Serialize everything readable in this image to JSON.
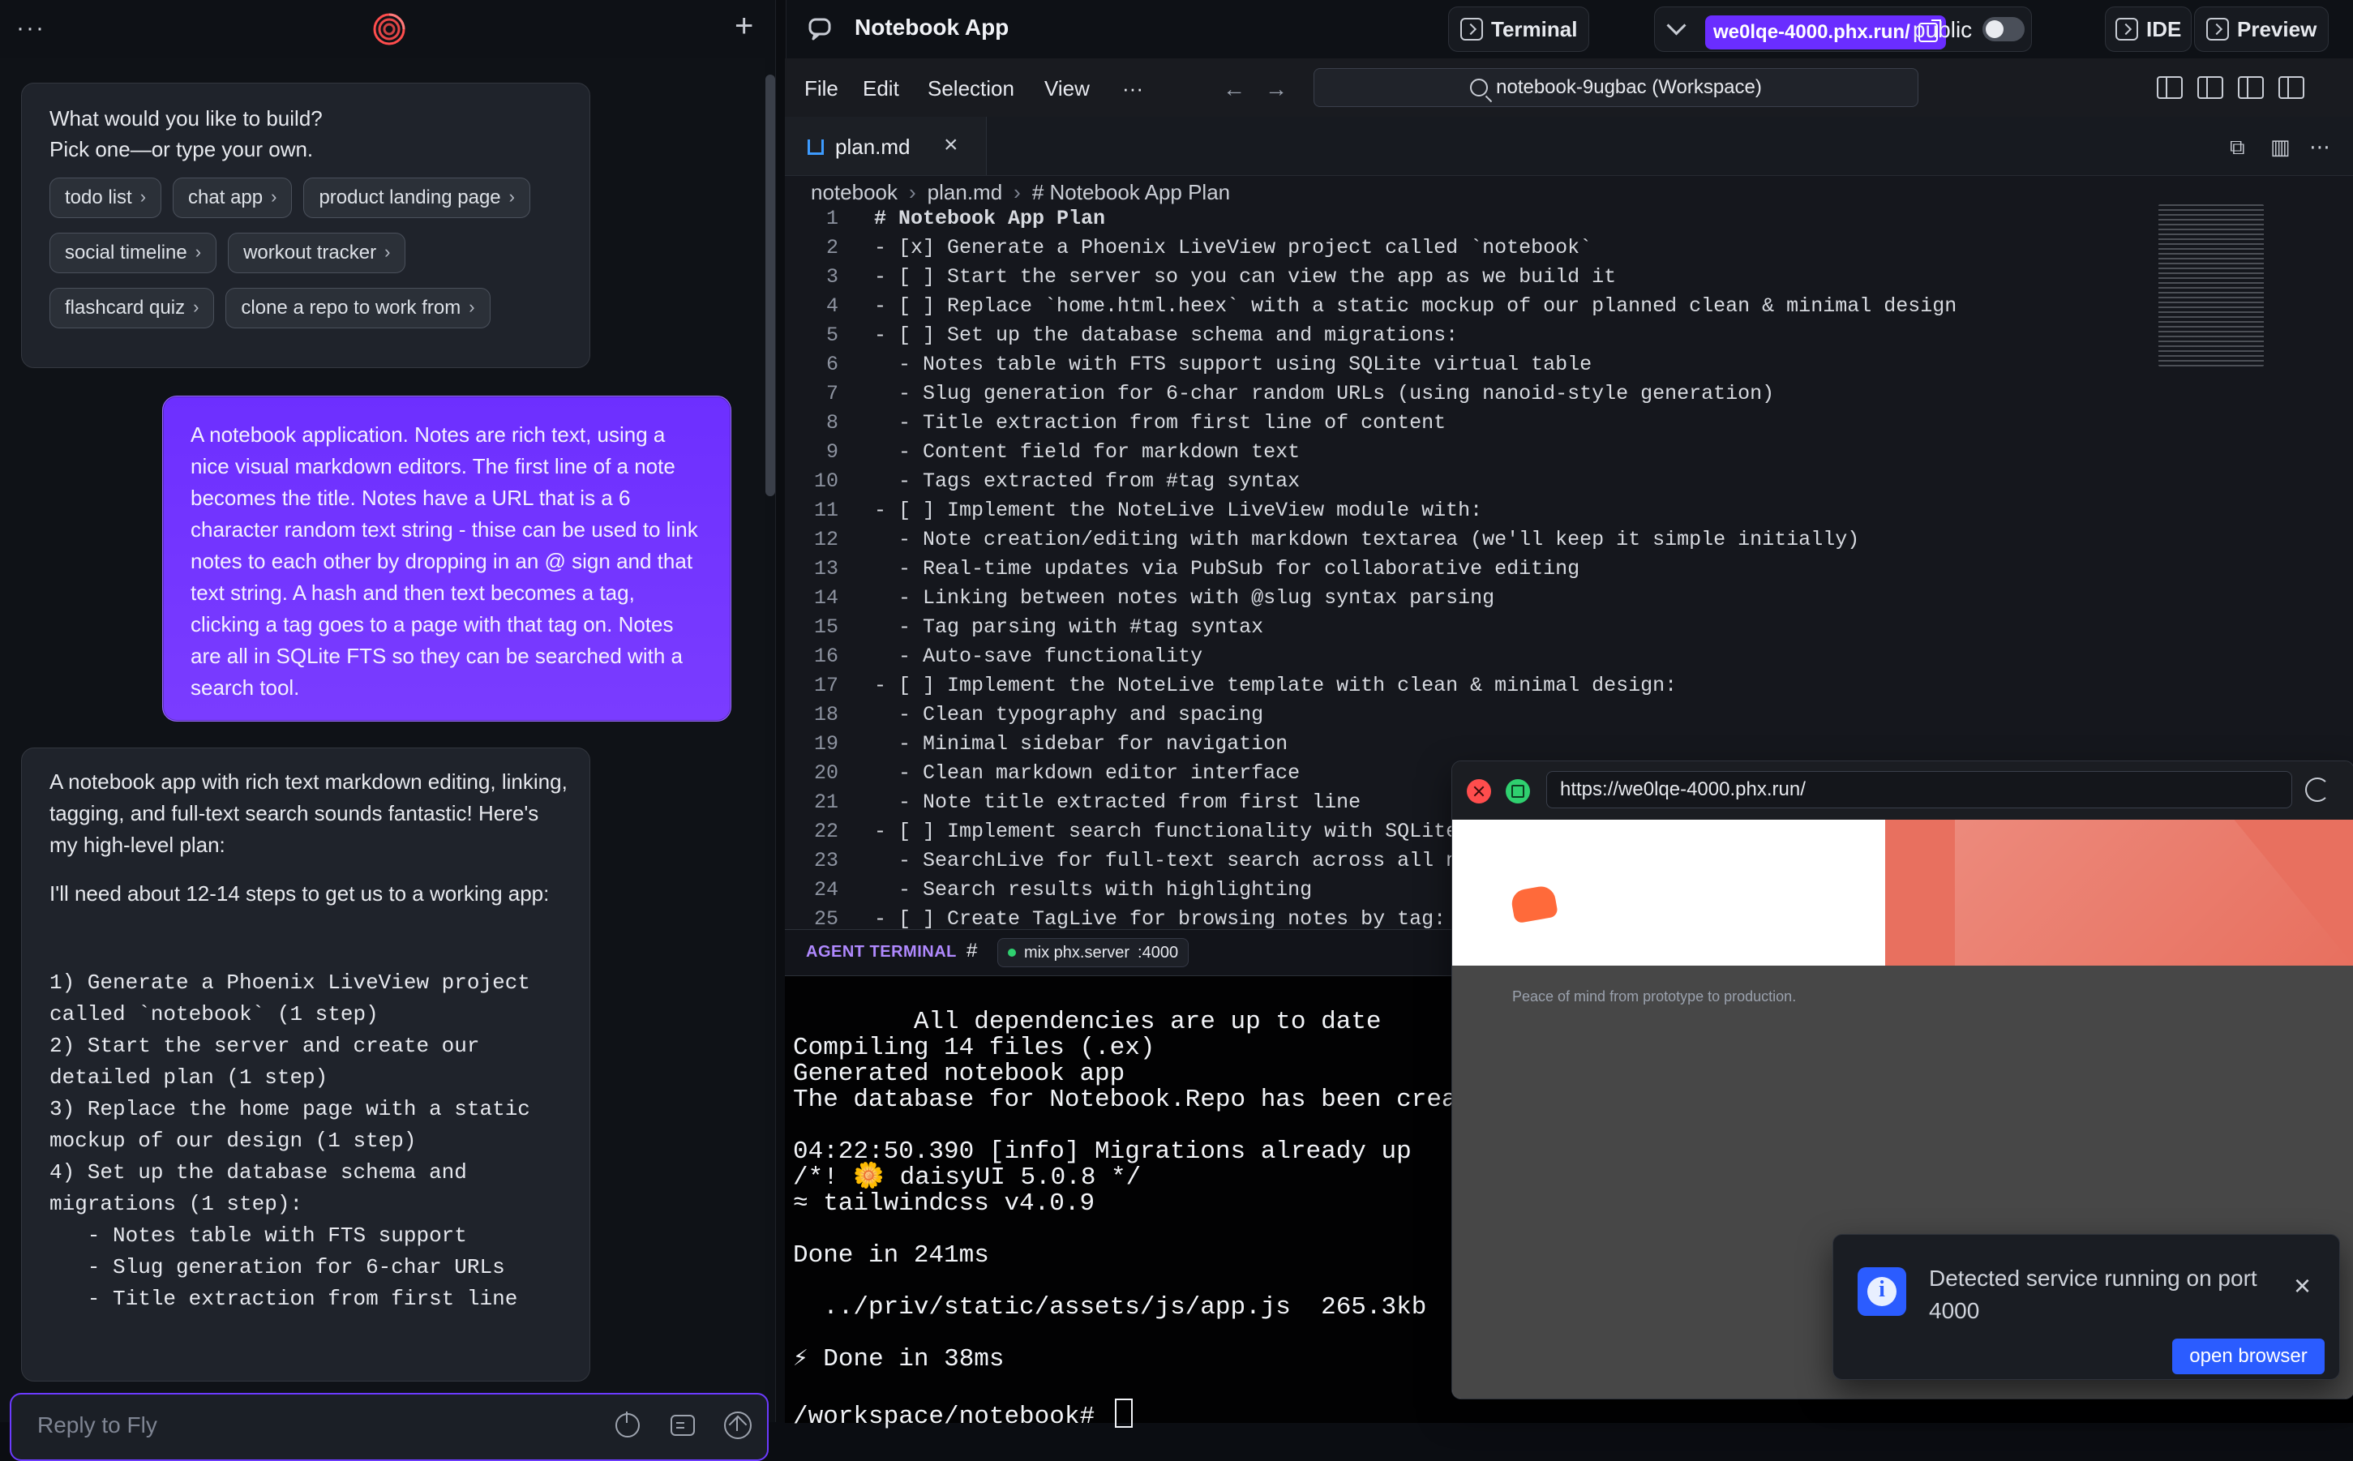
{
  "left": {
    "suggestions_card": {
      "title_line1": "What would you like to build?",
      "title_line2": "Pick one—or type your own.",
      "chips": [
        "todo list",
        "chat app",
        "product landing page",
        "social timeline",
        "workout tracker",
        "flashcard quiz",
        "clone a repo to work from"
      ]
    },
    "user_message": "A notebook application. Notes are rich text, using a nice visual markdown editors. The first line of a note becomes the title. Notes have a URL that is a 6 character random text string - thise can be used to link notes to each other by dropping in an @ sign and that text string. A hash and then text becomes a tag, clicking a tag goes to a page with that tag on. Notes are all in SQLite FTS so they can be searched with a search tool.",
    "assistant_response": {
      "p1": "A notebook app with rich text markdown editing, linking, tagging, and full-text search sounds fantastic! Here's my high-level plan:",
      "p2": "I'll need about 12-14 steps to get us to a working app:",
      "steps_text": "1) Generate a Phoenix LiveView project\ncalled `notebook` (1 step)\n2) Start the server and create our\ndetailed plan (1 step)\n3) Replace the home page with a static\nmockup of our design (1 step)\n4) Set up the database schema and\nmigrations (1 step):\n   - Notes table with FTS support\n   - Slug generation for 6-char URLs\n   - Title extraction from first line"
    },
    "reply_placeholder": "Reply to Fly"
  },
  "right": {
    "app_title": "Notebook App",
    "header_buttons": {
      "terminal": "Terminal",
      "preview_url": "we0lqe-4000.phx.run/",
      "visibility_label": "public",
      "ide": "IDE",
      "preview": "Preview"
    },
    "menu": {
      "file": "File",
      "edit": "Edit",
      "selection": "Selection",
      "view": "View",
      "more": "···"
    },
    "workspace_search": "notebook-9ugbac (Workspace)",
    "tab": {
      "name": "plan.md"
    },
    "breadcrumbs": [
      "notebook",
      "plan.md",
      "# Notebook App Plan"
    ],
    "editor_lines": [
      {
        "n": "1",
        "t": "# Notebook App Plan",
        "kind": "hdr"
      },
      {
        "n": "2",
        "t": "- [x] Generate a Phoenix LiveView project called `notebook`",
        "kind": "normal"
      },
      {
        "n": "3",
        "t": "- [ ] Start the server so you can view the app as we build it",
        "kind": "normal"
      },
      {
        "n": "4",
        "t": "- [ ] Replace `home.html.heex` with a static mockup of our planned clean & minimal design",
        "kind": "normal"
      },
      {
        "n": "5",
        "t": "- [ ] Set up the database schema and migrations:",
        "kind": "normal"
      },
      {
        "n": "6",
        "t": "  - Notes table with FTS support using SQLite virtual table",
        "kind": "normal"
      },
      {
        "n": "7",
        "t": "  - Slug generation for 6-char random URLs (using nanoid-style generation)",
        "kind": "normal"
      },
      {
        "n": "8",
        "t": "  - Title extraction from first line of content",
        "kind": "normal"
      },
      {
        "n": "9",
        "t": "  - Content field for markdown text",
        "kind": "normal"
      },
      {
        "n": "10",
        "t": "  - Tags extracted from #tag syntax",
        "kind": "normal"
      },
      {
        "n": "11",
        "t": "- [ ] Implement the NoteLive LiveView module with:",
        "kind": "normal"
      },
      {
        "n": "12",
        "t": "  - Note creation/editing with markdown textarea (we'll keep it simple initially)",
        "kind": "normal"
      },
      {
        "n": "13",
        "t": "  - Real-time updates via PubSub for collaborative editing",
        "kind": "normal"
      },
      {
        "n": "14",
        "t": "  - Linking between notes with @slug syntax parsing",
        "kind": "normal"
      },
      {
        "n": "15",
        "t": "  - Tag parsing with #tag syntax",
        "kind": "normal"
      },
      {
        "n": "16",
        "t": "  - Auto-save functionality",
        "kind": "normal"
      },
      {
        "n": "17",
        "t": "- [ ] Implement the NoteLive template with clean & minimal design:",
        "kind": "normal"
      },
      {
        "n": "18",
        "t": "  - Clean typography and spacing",
        "kind": "normal"
      },
      {
        "n": "19",
        "t": "  - Minimal sidebar for navigation",
        "kind": "normal"
      },
      {
        "n": "20",
        "t": "  - Clean markdown editor interface",
        "kind": "normal"
      },
      {
        "n": "21",
        "t": "  - Note title extracted from first line",
        "kind": "normal"
      },
      {
        "n": "22",
        "t": "- [ ] Implement search functionality with SQLite",
        "kind": "normal"
      },
      {
        "n": "23",
        "t": "  - SearchLive for full-text search across all n",
        "kind": "normal"
      },
      {
        "n": "24",
        "t": "  - Search results with highlighting",
        "kind": "normal"
      },
      {
        "n": "25",
        "t": "- [ ] Create TagLive for browsing notes by tag:",
        "kind": "normal"
      }
    ],
    "agent_terminal": {
      "title": "AGENT TERMINAL",
      "hash": "#",
      "server_label": "mix phx.server",
      "server_port": ":4000",
      "output": "All dependencies are up to date\nCompiling 14 files (.ex)\nGenerated notebook app\nThe database for Notebook.Repo has been created\n\n04:22:50.390 [info] Migrations already up\n/*! 🌼 daisyUI 5.0.8 */\n≈ tailwindcss v4.0.9\n\nDone in 241ms\n\n  ../priv/static/assets/js/app.js  265.3kb\n\n⚡ Done in 38ms\n\n/workspace/notebook# "
    },
    "preview_window": {
      "url": "https://we0lqe-4000.phx.run/",
      "snippet1": "Peace of mind from prototype to production."
    },
    "toast": {
      "message": "Detected service running on port 4000",
      "button": "open browser"
    }
  }
}
